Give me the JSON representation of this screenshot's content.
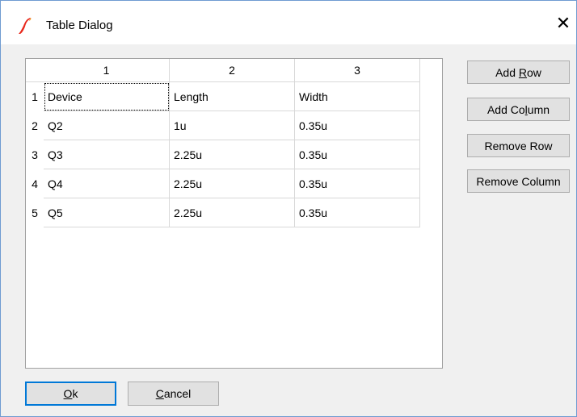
{
  "window": {
    "title": "Table Dialog",
    "close_symbol": "✕",
    "accent_color": "#0078d7"
  },
  "table": {
    "columns": [
      "1",
      "2",
      "3"
    ],
    "row_numbers": [
      "1",
      "2",
      "3",
      "4",
      "5"
    ],
    "rows": [
      [
        "Device",
        "Length",
        "Width"
      ],
      [
        "Q2",
        "1u",
        "0.35u"
      ],
      [
        "Q3",
        "2.25u",
        "0.35u"
      ],
      [
        "Q4",
        "2.25u",
        "0.35u"
      ],
      [
        "Q5",
        "2.25u",
        "0.35u"
      ]
    ]
  },
  "side_buttons": {
    "add_row": {
      "pre": "Add ",
      "key": "R",
      "post": "ow"
    },
    "add_column": {
      "pre": "Add Co",
      "key": "l",
      "post": "umn"
    },
    "remove_row": {
      "pre": "Remove Row",
      "key": "",
      "post": ""
    },
    "remove_column": {
      "pre": "Remove Column",
      "key": "",
      "post": ""
    }
  },
  "bottom_buttons": {
    "ok": {
      "pre": "",
      "key": "O",
      "post": "k"
    },
    "cancel": {
      "pre": "",
      "key": "C",
      "post": "ancel"
    }
  }
}
